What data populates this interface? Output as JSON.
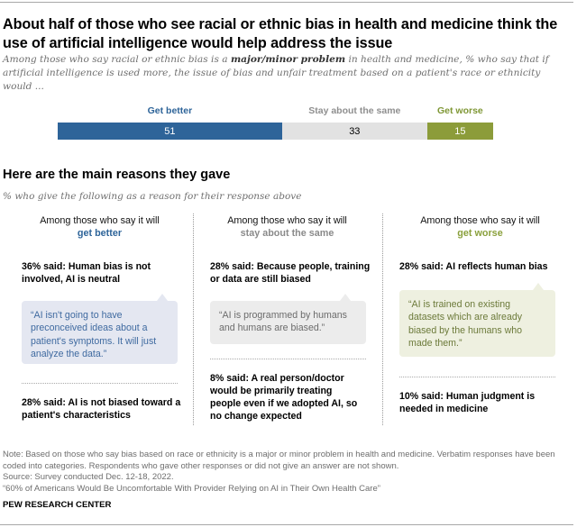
{
  "title": "About half of those who see racial or ethnic bias in health and medicine think the use of artificial intelligence would help address the issue",
  "subtitle": {
    "before": "Among those who say racial or ethnic bias is a ",
    "bold": "major/minor problem",
    "after": " in health and medicine, % who say that if artificial intelligence is used more, the issue of bias and unfair treatment based on a patient's race or ethnicity would ..."
  },
  "chart_data": {
    "type": "bar",
    "orientation": "horizontal-stacked",
    "title": "About half of those who see racial or ethnic bias in health and medicine think the use of artificial intelligence would help address the issue",
    "categories": [
      "Get better",
      "Stay about the same",
      "Get worse"
    ],
    "values": [
      51,
      33,
      15
    ],
    "colors": [
      "#2e6499",
      "#e2e2e2",
      "#8c9c3a"
    ],
    "label_colors": [
      "#2e6499",
      "#8f8f8f",
      "#7f9735"
    ],
    "value_text_colors": [
      "#ffffff",
      "#000000",
      "#ffffff"
    ],
    "xlabel": "",
    "ylabel": "",
    "xlim": [
      0,
      100
    ],
    "grid": false,
    "legend": "top"
  },
  "section": {
    "heading": "Here are the main reasons they gave",
    "subheading": "% who give the following as a reason for their response above"
  },
  "columns": [
    {
      "head": "Among those who say it will",
      "emphasis": "get better",
      "emphasis_color": "#2e6499",
      "reason1": "36% said: Human bias is not involved, AI is neutral",
      "quote": "“AI isn't going to have preconceived ideas about a patient's symptoms. It will just analyze the data.”",
      "quote_bg": "#e4e7f1",
      "quote_color": "#3f6aa0",
      "reason2": "28% said: AI is not biased toward a patient's characteristics"
    },
    {
      "head": "Among those who say it will",
      "emphasis": "stay about the same",
      "emphasis_color": "#8a8a8a",
      "reason1": "28% said: Because people, training or data are still biased",
      "quote": "“AI is programmed by humans and humans are biased.”",
      "quote_bg": "#ececec",
      "quote_color": "#6b6b6b",
      "reason2": "8% said: A real person/doctor would be primarily treating people even if we adopted AI, so no change expected"
    },
    {
      "head": "Among those who say it will",
      "emphasis": "get worse",
      "emphasis_color": "#8aa03c",
      "reason1": "28% said: AI reflects human bias",
      "quote": "“AI is trained on existing datasets which are already biased by the humans who made them.”",
      "quote_bg": "#eef0e0",
      "quote_color": "#6c7a3a",
      "reason2": "10% said: Human judgment is needed in medicine"
    }
  ],
  "footer": {
    "note": "Note: Based on those who say bias based on race or ethnicity is a major or minor problem in health and medicine. Verbatim responses have been coded into categories. Respondents who gave other responses or did not give an answer are not shown.",
    "source": "Source: Survey conducted Dec. 12-18, 2022.",
    "report": "“60% of Americans Would Be Uncomfortable With Provider Relying on AI in Their Own Health Care”",
    "brand": "PEW RESEARCH CENTER"
  }
}
